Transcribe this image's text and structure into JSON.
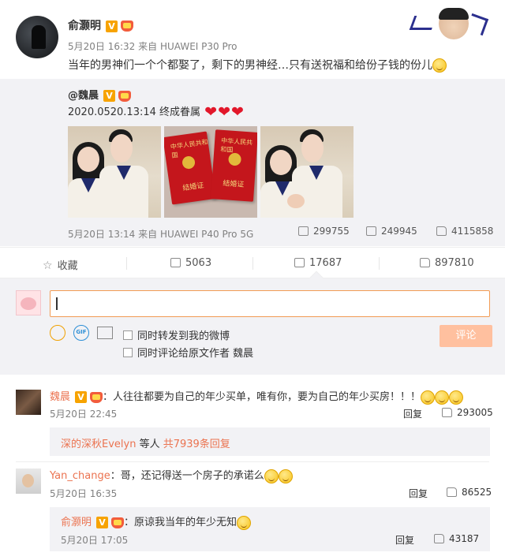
{
  "post": {
    "author": "俞灏明",
    "verified": "V",
    "time": "5月20日 16:32",
    "source_prefix": "来自",
    "device": "HUAWEI P30 Pro",
    "text": "当年的男神们一个个都娶了，剩下的男神经…只有送祝福和给份子钱的份儿"
  },
  "repost": {
    "author": "@魏晨",
    "text": "2020.0520.13:14 终成眷属",
    "hearts": [
      "❤",
      "❤",
      "❤"
    ],
    "photo1_alt": "couple photo",
    "photo2_alt": "marriage certificates",
    "photo3_alt": "couple photo heart hands",
    "certificate_label": "结婚证",
    "certificate_header": "中华人民共和国",
    "time": "5月20日 13:14",
    "source_prefix": "来自",
    "device": "HUAWEI P40 Pro 5G",
    "forwards": "299755",
    "comments": "249945",
    "likes": "4115858"
  },
  "actions": {
    "favorite": "收藏",
    "forward": "5063",
    "comment": "17687",
    "like": "897810"
  },
  "compose": {
    "input_value": "",
    "check1": "同时转发到我的微博",
    "check2": "同时评论给原文作者 魏晨",
    "submit": "评论",
    "gif": "GIF"
  },
  "comments": [
    {
      "name": "魏晨",
      "text": "：人往往都要为自己的年少买单，唯有你，要为自己的年少买房！！！",
      "time": "5月20日 22:45",
      "reply": "回复",
      "likes": "293005",
      "replies_user": "深的深秋Evelyn",
      "replies_mid": " 等人 ",
      "replies_link": "共7939条回复"
    },
    {
      "name": "Yan_change",
      "text": "：哥，还记得送一个房子的承诺么",
      "time": "5月20日 16:35",
      "reply": "回复",
      "likes": "86525",
      "sub": {
        "name": "俞灏明",
        "text": "：原谅我当年的年少无知",
        "time": "5月20日 17:05",
        "reply": "回复",
        "likes": "43187"
      }
    }
  ],
  "colors": {
    "accent": "#eb7350",
    "verified": "#f7a300",
    "submit_disabled": "#ffc09f",
    "panel_bg": "#f2f2f5"
  }
}
